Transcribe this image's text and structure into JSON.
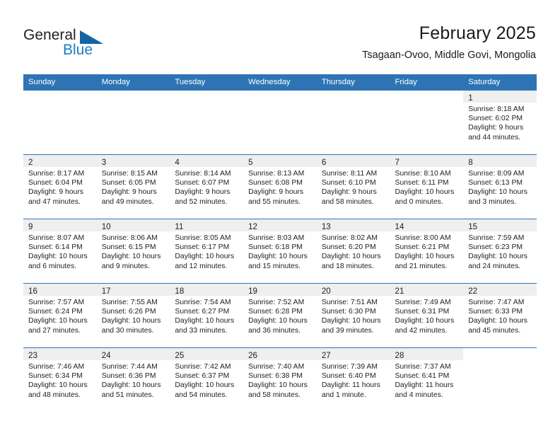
{
  "brand": {
    "name_part1": "General",
    "name_part2": "Blue",
    "accent_color": "#1b7cc4",
    "triangle_color": "#1464a5"
  },
  "header": {
    "title": "February 2025",
    "subtitle": "Tsagaan-Ovoo, Middle Govi, Mongolia",
    "header_bg_color": "#2e74b5"
  },
  "calendar": {
    "weekday_headers": [
      "Sunday",
      "Monday",
      "Tuesday",
      "Wednesday",
      "Thursday",
      "Friday",
      "Saturday"
    ],
    "weeks": [
      [
        {
          "day": "",
          "lines": []
        },
        {
          "day": "",
          "lines": []
        },
        {
          "day": "",
          "lines": []
        },
        {
          "day": "",
          "lines": []
        },
        {
          "day": "",
          "lines": []
        },
        {
          "day": "",
          "lines": []
        },
        {
          "day": "1",
          "lines": [
            "Sunrise: 8:18 AM",
            "Sunset: 6:02 PM",
            "Daylight: 9 hours",
            "and 44 minutes."
          ]
        }
      ],
      [
        {
          "day": "2",
          "lines": [
            "Sunrise: 8:17 AM",
            "Sunset: 6:04 PM",
            "Daylight: 9 hours",
            "and 47 minutes."
          ]
        },
        {
          "day": "3",
          "lines": [
            "Sunrise: 8:15 AM",
            "Sunset: 6:05 PM",
            "Daylight: 9 hours",
            "and 49 minutes."
          ]
        },
        {
          "day": "4",
          "lines": [
            "Sunrise: 8:14 AM",
            "Sunset: 6:07 PM",
            "Daylight: 9 hours",
            "and 52 minutes."
          ]
        },
        {
          "day": "5",
          "lines": [
            "Sunrise: 8:13 AM",
            "Sunset: 6:08 PM",
            "Daylight: 9 hours",
            "and 55 minutes."
          ]
        },
        {
          "day": "6",
          "lines": [
            "Sunrise: 8:11 AM",
            "Sunset: 6:10 PM",
            "Daylight: 9 hours",
            "and 58 minutes."
          ]
        },
        {
          "day": "7",
          "lines": [
            "Sunrise: 8:10 AM",
            "Sunset: 6:11 PM",
            "Daylight: 10 hours",
            "and 0 minutes."
          ]
        },
        {
          "day": "8",
          "lines": [
            "Sunrise: 8:09 AM",
            "Sunset: 6:13 PM",
            "Daylight: 10 hours",
            "and 3 minutes."
          ]
        }
      ],
      [
        {
          "day": "9",
          "lines": [
            "Sunrise: 8:07 AM",
            "Sunset: 6:14 PM",
            "Daylight: 10 hours",
            "and 6 minutes."
          ]
        },
        {
          "day": "10",
          "lines": [
            "Sunrise: 8:06 AM",
            "Sunset: 6:15 PM",
            "Daylight: 10 hours",
            "and 9 minutes."
          ]
        },
        {
          "day": "11",
          "lines": [
            "Sunrise: 8:05 AM",
            "Sunset: 6:17 PM",
            "Daylight: 10 hours",
            "and 12 minutes."
          ]
        },
        {
          "day": "12",
          "lines": [
            "Sunrise: 8:03 AM",
            "Sunset: 6:18 PM",
            "Daylight: 10 hours",
            "and 15 minutes."
          ]
        },
        {
          "day": "13",
          "lines": [
            "Sunrise: 8:02 AM",
            "Sunset: 6:20 PM",
            "Daylight: 10 hours",
            "and 18 minutes."
          ]
        },
        {
          "day": "14",
          "lines": [
            "Sunrise: 8:00 AM",
            "Sunset: 6:21 PM",
            "Daylight: 10 hours",
            "and 21 minutes."
          ]
        },
        {
          "day": "15",
          "lines": [
            "Sunrise: 7:59 AM",
            "Sunset: 6:23 PM",
            "Daylight: 10 hours",
            "and 24 minutes."
          ]
        }
      ],
      [
        {
          "day": "16",
          "lines": [
            "Sunrise: 7:57 AM",
            "Sunset: 6:24 PM",
            "Daylight: 10 hours",
            "and 27 minutes."
          ]
        },
        {
          "day": "17",
          "lines": [
            "Sunrise: 7:55 AM",
            "Sunset: 6:26 PM",
            "Daylight: 10 hours",
            "and 30 minutes."
          ]
        },
        {
          "day": "18",
          "lines": [
            "Sunrise: 7:54 AM",
            "Sunset: 6:27 PM",
            "Daylight: 10 hours",
            "and 33 minutes."
          ]
        },
        {
          "day": "19",
          "lines": [
            "Sunrise: 7:52 AM",
            "Sunset: 6:28 PM",
            "Daylight: 10 hours",
            "and 36 minutes."
          ]
        },
        {
          "day": "20",
          "lines": [
            "Sunrise: 7:51 AM",
            "Sunset: 6:30 PM",
            "Daylight: 10 hours",
            "and 39 minutes."
          ]
        },
        {
          "day": "21",
          "lines": [
            "Sunrise: 7:49 AM",
            "Sunset: 6:31 PM",
            "Daylight: 10 hours",
            "and 42 minutes."
          ]
        },
        {
          "day": "22",
          "lines": [
            "Sunrise: 7:47 AM",
            "Sunset: 6:33 PM",
            "Daylight: 10 hours",
            "and 45 minutes."
          ]
        }
      ],
      [
        {
          "day": "23",
          "lines": [
            "Sunrise: 7:46 AM",
            "Sunset: 6:34 PM",
            "Daylight: 10 hours",
            "and 48 minutes."
          ]
        },
        {
          "day": "24",
          "lines": [
            "Sunrise: 7:44 AM",
            "Sunset: 6:36 PM",
            "Daylight: 10 hours",
            "and 51 minutes."
          ]
        },
        {
          "day": "25",
          "lines": [
            "Sunrise: 7:42 AM",
            "Sunset: 6:37 PM",
            "Daylight: 10 hours",
            "and 54 minutes."
          ]
        },
        {
          "day": "26",
          "lines": [
            "Sunrise: 7:40 AM",
            "Sunset: 6:38 PM",
            "Daylight: 10 hours",
            "and 58 minutes."
          ]
        },
        {
          "day": "27",
          "lines": [
            "Sunrise: 7:39 AM",
            "Sunset: 6:40 PM",
            "Daylight: 11 hours",
            "and 1 minute."
          ]
        },
        {
          "day": "28",
          "lines": [
            "Sunrise: 7:37 AM",
            "Sunset: 6:41 PM",
            "Daylight: 11 hours",
            "and 4 minutes."
          ]
        },
        {
          "day": "",
          "lines": []
        }
      ]
    ]
  }
}
